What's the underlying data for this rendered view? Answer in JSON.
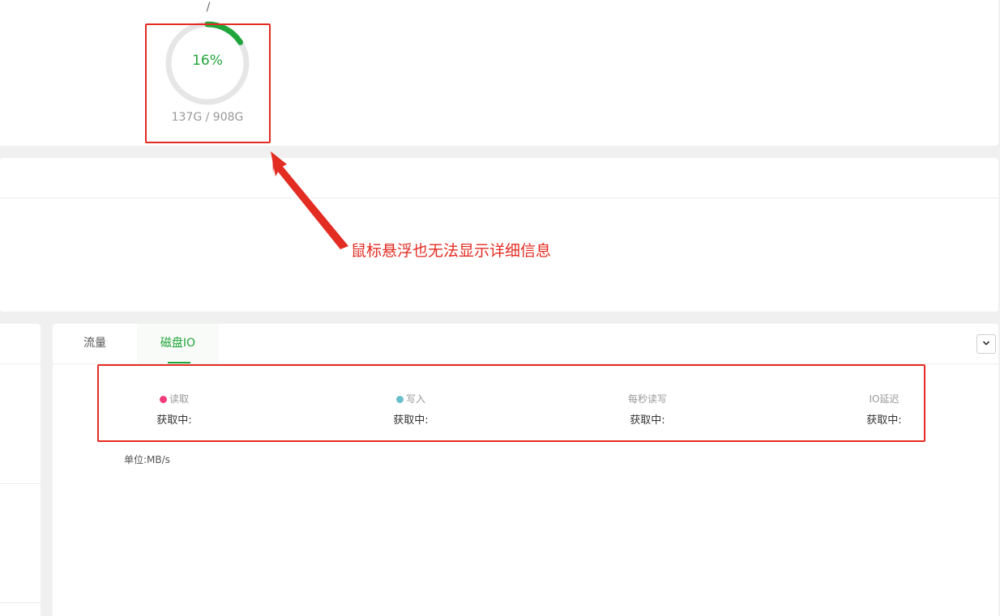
{
  "disk": {
    "mount": "/",
    "percent": 16,
    "percent_label": "16%",
    "size_label": "137G / 908G",
    "gauge_color": "#20a53a",
    "track_color": "#e6e6e6"
  },
  "monitor": {
    "tabs": [
      {
        "label": "流量",
        "active": false
      },
      {
        "label": "磁盘IO",
        "active": true
      }
    ],
    "select_icon": "chevron-down-icon",
    "metrics": [
      {
        "label": "读取",
        "value": "获取中:",
        "dot_color": "#ef3b7a"
      },
      {
        "label": "写入",
        "value": "获取中:",
        "dot_color": "#6bbfcc"
      },
      {
        "label": "每秒读写",
        "value": "获取中:"
      },
      {
        "label": "IO延迟",
        "value": "获取中:"
      }
    ],
    "unit": "单位:MB/s"
  },
  "annotation": {
    "text": "鼠标悬浮也无法显示详细信息",
    "color": "#e32c22"
  }
}
